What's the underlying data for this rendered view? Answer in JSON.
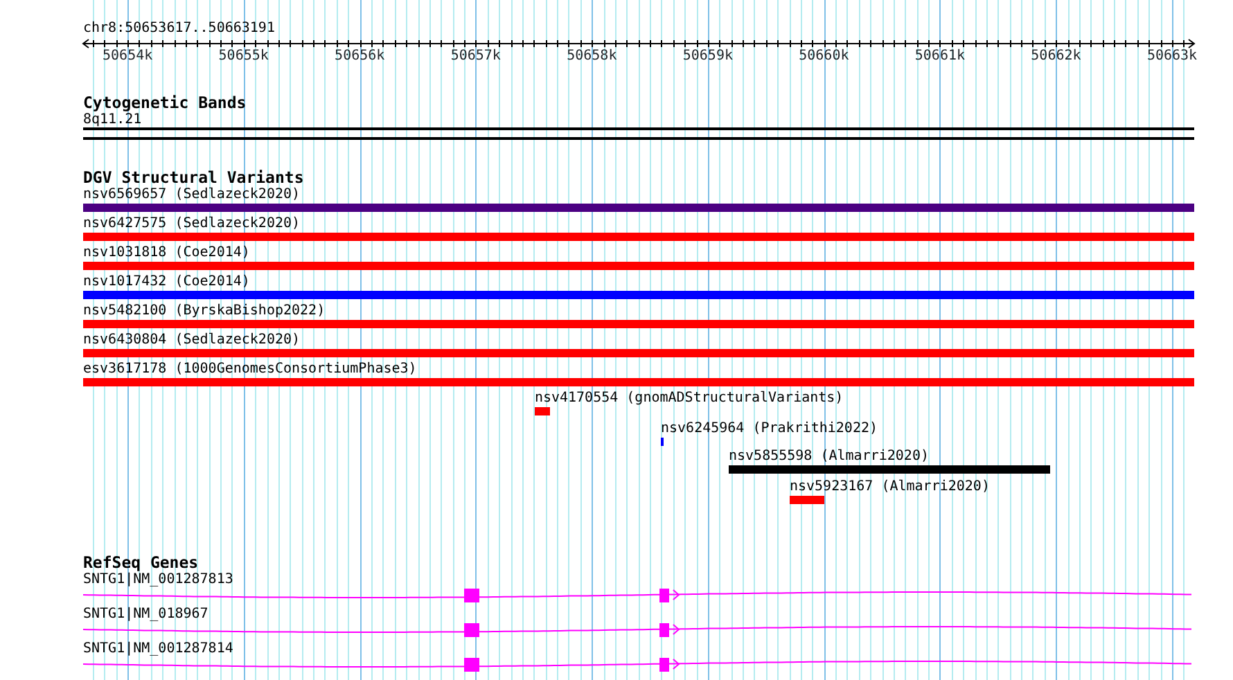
{
  "view": {
    "location": "chr8:50653617..50663191"
  },
  "ruler": {
    "ticks": [
      {
        "label": "50654k"
      },
      {
        "label": "50655k"
      },
      {
        "label": "50656k"
      },
      {
        "label": "50657k"
      },
      {
        "label": "50658k"
      },
      {
        "label": "50659k"
      },
      {
        "label": "50660k"
      },
      {
        "label": "50661k"
      },
      {
        "label": "50662k"
      },
      {
        "label": "50663k"
      }
    ]
  },
  "cytogenetic_bands": {
    "title": "Cytogenetic Bands",
    "bands": [
      {
        "name": "8q11.21"
      }
    ]
  },
  "dgv_structural_variants": {
    "title": "DGV Structural Variants",
    "features": [
      {
        "name": "nsv6569657 (Sedlazeck2020)",
        "color": "#4b0082"
      },
      {
        "name": "nsv6427575 (Sedlazeck2020)",
        "color": "#ff0000"
      },
      {
        "name": "nsv1031818 (Coe2014)",
        "color": "#ff0000"
      },
      {
        "name": "nsv1017432 (Coe2014)",
        "color": "#0000ff"
      },
      {
        "name": "nsv5482100 (ByrskaBishop2022)",
        "color": "#ff0000"
      },
      {
        "name": "nsv6430804 (Sedlazeck2020)",
        "color": "#ff0000"
      },
      {
        "name": "esv3617178 (1000GenomesConsortiumPhase3)",
        "color": "#ff0000"
      },
      {
        "name": "nsv4170554 (gnomADStructuralVariants)",
        "color": "#ff0000"
      },
      {
        "name": "nsv6245964 (Prakrithi2022)",
        "color": "#0000ff"
      },
      {
        "name": "nsv5855598 (Almarri2020)",
        "color": "#000000"
      },
      {
        "name": "nsv5923167 (Almarri2020)",
        "color": "#ff0000"
      }
    ]
  },
  "refseq_genes": {
    "title": "RefSeq Genes",
    "transcripts": [
      {
        "name": "SNTG1|NM_001287813",
        "reverse": false
      },
      {
        "name": "SNTG1|NM_018967",
        "reverse": false
      },
      {
        "name": "SNTG1|NM_001287814",
        "reverse": false
      }
    ]
  }
}
